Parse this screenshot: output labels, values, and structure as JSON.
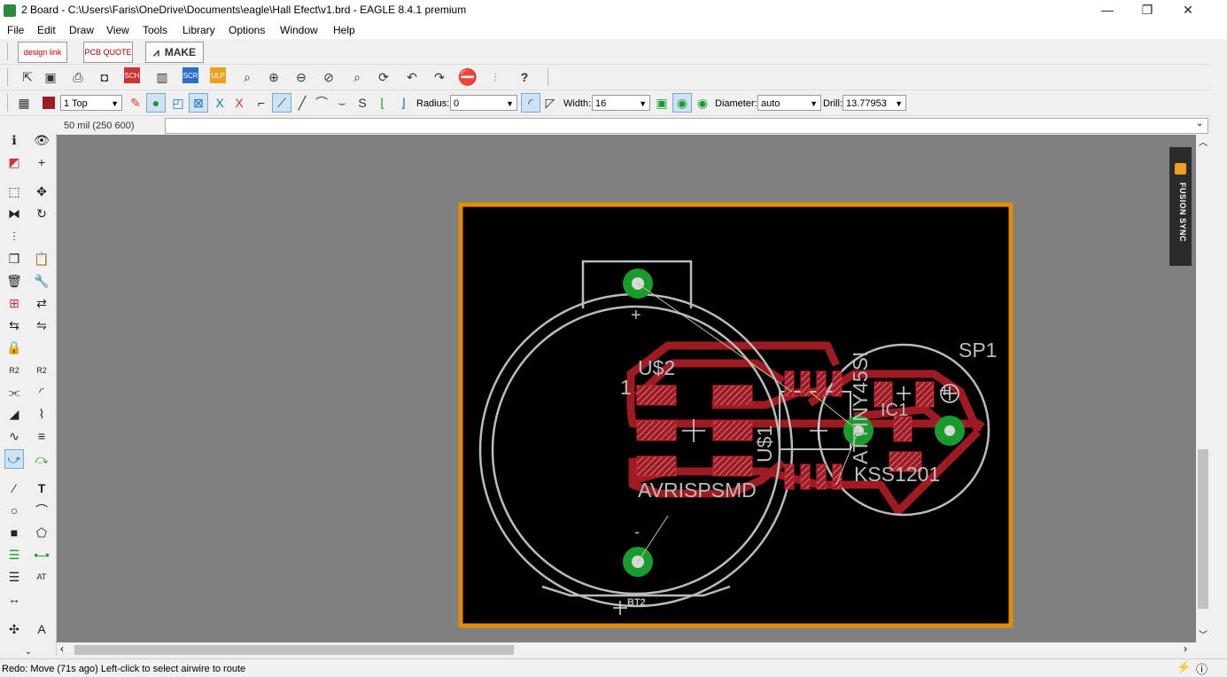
{
  "window": {
    "title": "2 Board - C:\\Users\\Faris\\OneDrive\\Documents\\eagle\\Hall Efect\\v1.brd - EAGLE 8.4.1 premium",
    "minimize": "—",
    "restore": "❐",
    "close": "✕"
  },
  "menu": {
    "items": [
      "File",
      "Edit",
      "Draw",
      "View",
      "Tools",
      "Library",
      "Options",
      "Window",
      "Help"
    ]
  },
  "brand_toolbar": {
    "designlink": "design link",
    "pcbquote": "PCB QUOTE",
    "make": "MAKE"
  },
  "params_toolbar": {
    "layer": "1 Top",
    "radius_label": "Radius:",
    "radius_value": "0",
    "width_label": "Width:",
    "width_value": "16",
    "diameter_label": "Diameter:",
    "diameter_value": "auto",
    "drill_label": "Drill:",
    "drill_value": "13.77953"
  },
  "command": {
    "coord": "50 mil (250 600)",
    "input_value": ""
  },
  "board": {
    "labels": {
      "u2": "U$2",
      "pin1": "1",
      "avrispsmd": "AVRISPSMD",
      "u1": "U$1",
      "attiny": "ATTINY45SI",
      "sp1": "SP1",
      "kss": "KSS1201",
      "ic1": "IC1",
      "bt2": "BT2",
      "plus": "+",
      "minus": "-"
    },
    "colors": {
      "background": "#000000",
      "outline": "#e68a00",
      "copper": "#9e1b24",
      "silk": "#bcbcbc",
      "via": "#1a9b2e"
    }
  },
  "fusion_sync": {
    "label": "FUSION SYNC"
  },
  "status": {
    "text": "Redo: Move (71s ago) Left-click to select airwire to route"
  }
}
